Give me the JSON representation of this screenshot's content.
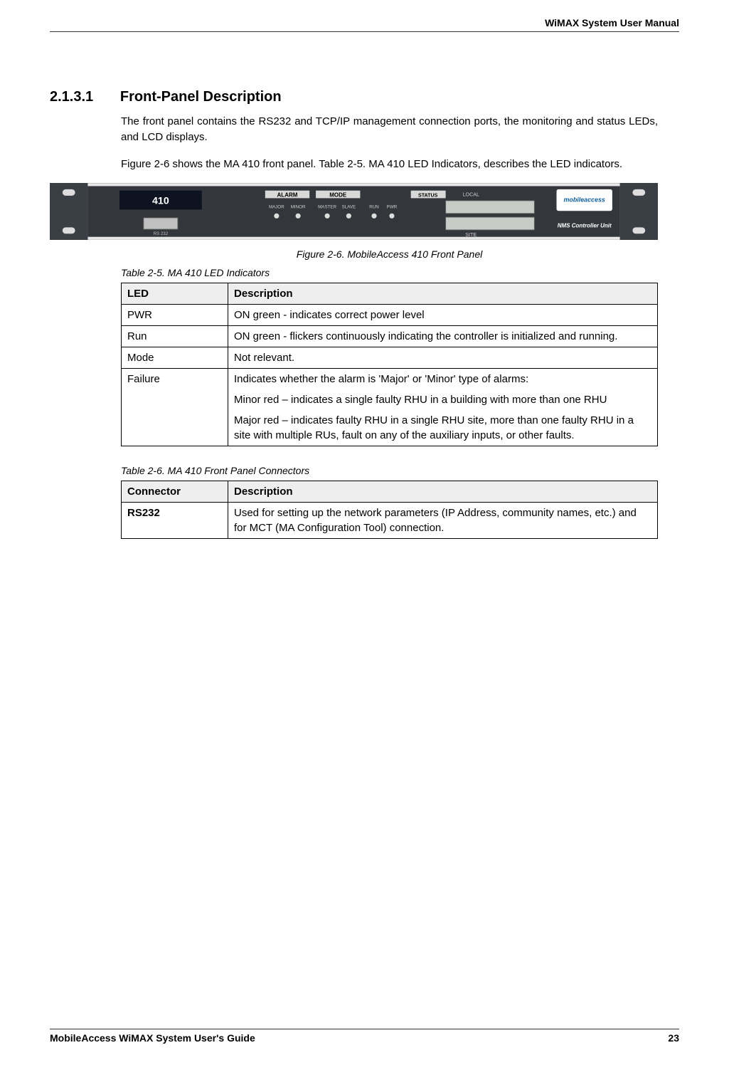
{
  "header": {
    "running": "WiMAX System User Manual"
  },
  "section": {
    "num": "2.1.3.1",
    "title": "Front-Panel Description"
  },
  "paragraphs": {
    "p1": "The front panel contains the RS232 and TCP/IP management connection ports, the monitoring and status LEDs, and LCD displays.",
    "p2": "Figure 2-6 shows the MA 410 front panel. Table 2-5.  MA 410 LED Indicators, describes the LED indicators."
  },
  "figure": {
    "caption": "Figure 2-6. MobileAccess 410 Front Panel",
    "labels": {
      "model": "410",
      "rs232": "RS 232",
      "alarm": "ALARM",
      "major": "MAJOR",
      "minor": "MINOR",
      "mode": "MODE",
      "master": "MASTER",
      "slave": "SLAVE",
      "run": "RUN",
      "pwr": "PWR",
      "status": "STATUS",
      "local": "LOCAL",
      "site": "SITE",
      "brand": "mobileaccess",
      "unit": "NMS Controller Unit"
    }
  },
  "table1": {
    "caption": "Table 2-5.  MA 410 LED Indicators",
    "head": {
      "c1": "LED",
      "c2": "Description"
    },
    "rows": [
      {
        "c1": "PWR",
        "c2": "ON green - indicates correct power level"
      },
      {
        "c1": "Run",
        "c2": "ON green - flickers continuously indicating the controller is initialized and running."
      },
      {
        "c1": "Mode",
        "c2": "Not relevant."
      },
      {
        "c1": "Failure",
        "c2a": "Indicates whether the alarm is 'Major' or 'Minor' type of alarms:",
        "c2b": "Minor red – indicates a single faulty RHU in a building with more than one RHU",
        "c2c": "Major red – indicates faulty RHU in a single RHU site, more than one faulty RHU in a site with multiple RUs, fault on any of the auxiliary inputs, or other faults."
      }
    ]
  },
  "table2": {
    "caption": "Table 2-6.  MA 410 Front Panel Connectors",
    "head": {
      "c1": "Connector",
      "c2": "Description"
    },
    "rows": [
      {
        "c1": "RS232",
        "c2": "Used for setting up the network parameters (IP Address, community names, etc.) and for MCT (MA Configuration Tool) connection."
      }
    ]
  },
  "footer": {
    "left": "MobileAccess WiMAX System User's Guide",
    "right": "23"
  }
}
